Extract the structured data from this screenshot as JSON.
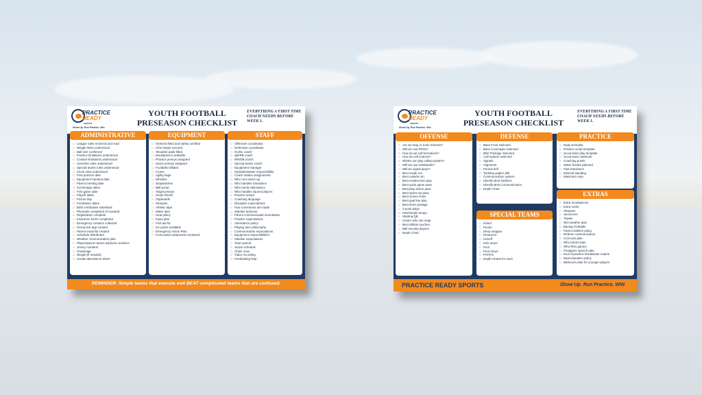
{
  "left_checklist": {
    "brand": {
      "line1": "PRACTICE",
      "line2": "READY",
      "line3": "SPORTS",
      "tagline": "Show Up. Run Practice. Win"
    },
    "title_line1": "YOUTH FOOTBALL",
    "title_line2": "PRESEASON CHECKLIST",
    "tagline": "EVERYTHING A FIRST TIME COACH NEEDS BEFORE WEEK 1.",
    "columns": [
      {
        "heading": "ADMINISTRATIVE",
        "items": [
          "League rules received and read",
          "Weight limits understood",
          "Ball size confirmed",
          "Practice limitations understood",
          "Contact limitations understood",
          "Overtime rules understood",
          "Special teams rules understood",
          "Clock rules understood",
          "First practice date",
          "Equipment handout date",
          "Parent meeting date",
          "Scrimmage dates",
          "First game date",
          "Playoff dates",
          "Picture day",
          "Fundraiser dates",
          "Birth certificates submitted",
          "Physicals completed (if needed)",
          "Registration complete",
          "Insurance forms completed",
          "Emergency contacts collected",
          "Group text app created",
          "Parent email list created",
          "Schedule distributed",
          "Weather communication plan",
          "Player/parent names w/phone numbers",
          "Jersey numbers",
          "Grade/age",
          "Weight (if needed)",
          "Create attendance sheet"
        ]
      },
      {
        "heading": "EQUIPMENT",
        "items": [
          "Helmets fitted and safety certified",
          "Chin straps secured",
          "Shoulder pads fitted",
          "Mouthpieces available",
          "Practice jerseys assigned",
          "Game jerseys assigned",
          "Footballs inflated",
          "Cones",
          "Agility bags",
          "Whistles",
          "Stopwatches",
          "Ball pump",
          "Target jerseys",
          "Script sheets",
          "Clipboards",
          "Sharpies",
          "Athletic tape",
          "Water plan",
          "Heat policy",
          "Injury plan",
          "First aid kit",
          "Ice packs available",
          "Emergency Action Plan",
          "Concussion awareness reviewed"
        ]
      },
      {
        "heading": "STAFF",
        "items": [
          "Offensive coordinator",
          "Defensive coordinator",
          "OL/DL coach",
          "QB/RB coach",
          "WR/DB coach",
          "Special teams coach",
          "Equipment manager",
          "Hydration/water responsibility",
          "Coach station assignments",
          "Who runs warm-up",
          "Who handles transitions",
          "Who tracks attendance",
          "Who handles injured players",
          "Practice tempo",
          "Coaching language",
          "Discipline expectations",
          "How corrections are made",
          "Sideline behavior",
          "Parent communication boundaries",
          "Practice expectations",
          "Attendance policy",
          "Playing time philosophy",
          "Communication expectations",
          "Equipment responsibilities",
          "Sideline expectations",
          "Team parent",
          "Snack schedule",
          "Chain crew",
          "Video recording",
          "Fundraising help"
        ]
      }
    ],
    "reminder": "REMINDER: Simple teams that execute well BEAT complicated teams that are confused."
  },
  "right_checklist": {
    "brand": {
      "line1": "PRACTICE",
      "line2": "READY",
      "line3": "SPORTS",
      "tagline": "Show Up. Run Practice. Win"
    },
    "title_line1": "YOUTH FOOTBALL",
    "title_line2": "PRESEASON CHECKLIST",
    "tagline": "EVERYTHING A FIRST TIME COACH NEEDS BEFORE WEEK 1.",
    "offense": {
      "heading": "OFFENSE",
      "items": [
        "Are we Gap or Zone Scheme?",
        "Will we use RPOs?",
        "How do we call formations?",
        "How do call motions?",
        "What's our play calling system?",
        "Will we use wristbands?",
        "Will we signal plays?",
        "Best inside run",
        "Best outside run",
        "Best misdirection play",
        "Best quick game pass",
        "Best play-action pass",
        "Best sprint-out pass",
        "Best screen Pass",
        "Best goal line play",
        "Best short yardage",
        "2-point plays",
        "Fast/simple tempo",
        "Starting QB",
        "Center who can snap",
        "Best athlete touches",
        "Ball security players",
        "Depth Chart"
      ]
    },
    "defense": {
      "heading": "DEFENSE",
      "items": [
        "Base Front Selected",
        "Base Coverages Selected",
        "Blitz Package Selected",
        "Call System Selected",
        "Signals",
        "Alignment",
        "Pursuit drill",
        "Tackling angles drill",
        "Communication system",
        "Identify Best Tacklers",
        "Identify Best Communicators",
        "Depth Chart"
      ]
    },
    "special_teams": {
      "heading": "SPECIAL TEAMS",
      "items": [
        "Kicker",
        "Punter",
        "Deep snapper",
        "Returners",
        "Kickoff",
        "Kick return",
        "Punt",
        "Punt return",
        "PAT/FG",
        "Depth Charts for each"
      ]
    },
    "practice": {
      "heading": "PRACTICE",
      "items": [
        "Daily schedule",
        "Practice script template",
        "Scout team play template",
        "Scout team notebook",
        "Coaching points",
        "Water breaks planned",
        "Fast transitions",
        "Minimal standing",
        "Maximum reps"
      ]
    },
    "extras": {
      "heading": "EXTRAS",
      "items": [
        "Extra mouthpieces",
        "Extra socks",
        "Sharpies",
        "Sunscreen",
        "Towels",
        "Wet weather plan",
        "Backup footballs",
        "Parent sideline policy",
        "Referee communication",
        "Coin toss plan",
        "Who tracks stats",
        "Who films games",
        "Postgame speech plan",
        "End-of-practice breakdown routine",
        "Music/speaker policy",
        "Bathroom plan for younger players"
      ]
    },
    "footer_left": "PRACTICE READY SPORTS",
    "footer_right": "Show Up. Run Practice. WIN"
  },
  "colors": {
    "navy": "#1f3a63",
    "orange": "#f28a1e"
  }
}
